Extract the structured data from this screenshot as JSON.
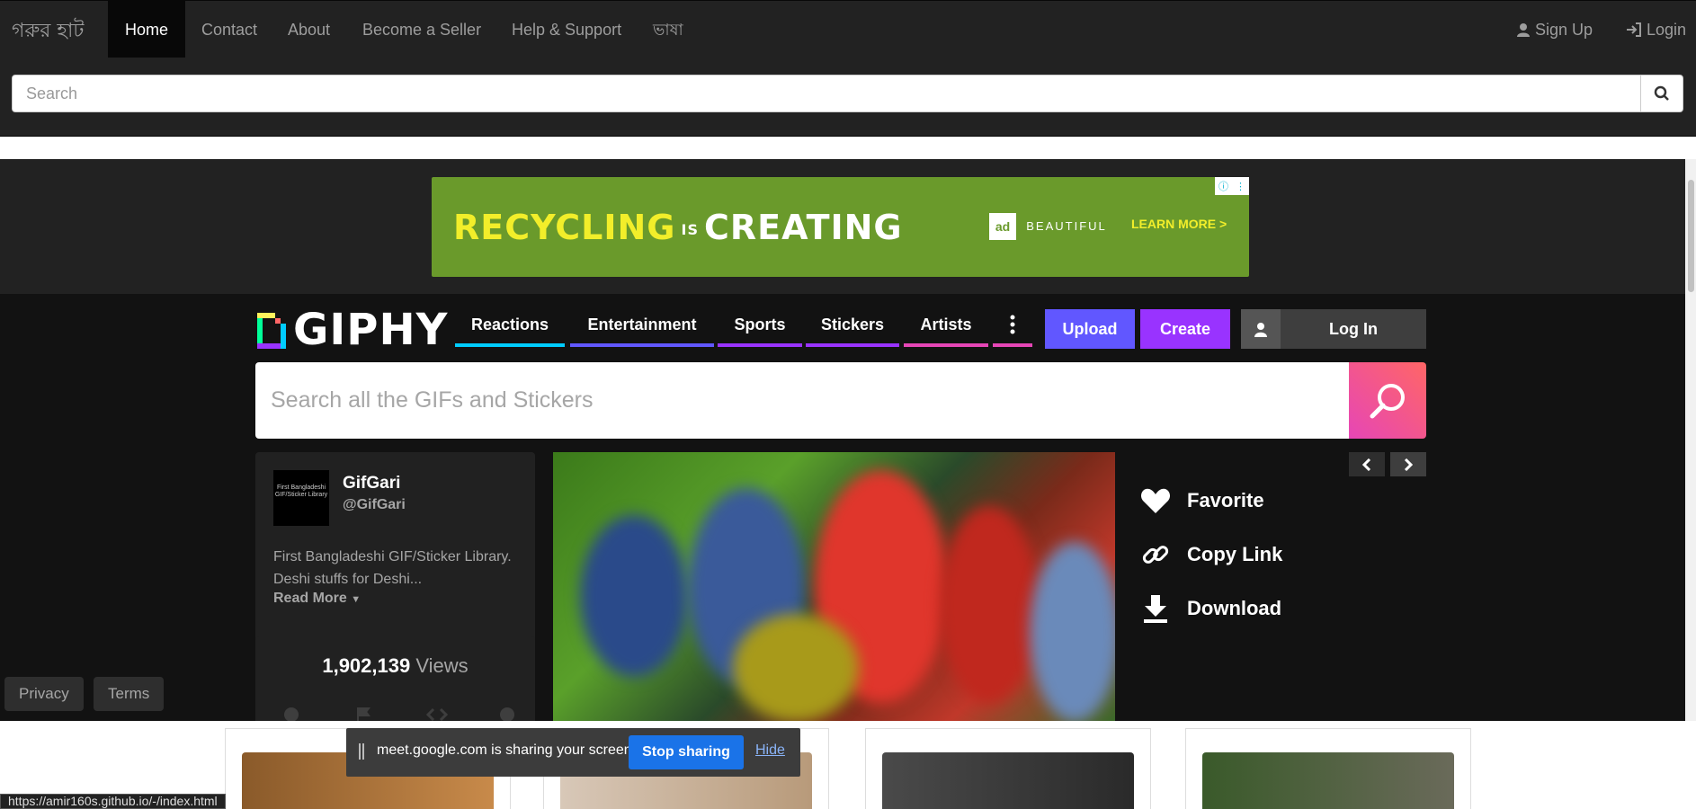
{
  "site": {
    "brand": "গরুর হাট",
    "nav": [
      "Home",
      "Contact",
      "About",
      "Become a Seller",
      "Help & Support",
      "ভাষা"
    ],
    "sign_up": "Sign Up",
    "login": "Login",
    "search_placeholder": "Search"
  },
  "ad": {
    "headline_1": "RECYCLING",
    "is": "IS",
    "headline_2": "CREATING",
    "logo": "ad",
    "brand": "BEAUTIFUL",
    "cta": "LEARN MORE >"
  },
  "giphy": {
    "logo": "GIPHY",
    "nav": [
      {
        "label": "Reactions",
        "color": "#00ccff"
      },
      {
        "label": "Entertainment",
        "color": "#6157ff"
      },
      {
        "label": "Sports",
        "color": "#9933ff"
      },
      {
        "label": "Stickers",
        "color": "#9933ff"
      },
      {
        "label": "Artists",
        "color": "#e646b6"
      }
    ],
    "upload": "Upload",
    "create": "Create",
    "login": "Log In",
    "search_placeholder": "Search all the GIFs and Stickers",
    "user": {
      "avatar_text": "First Bangladeshi GIF/Sticker Library",
      "name": "GifGari",
      "handle": "@GifGari",
      "bio": "First Bangladeshi GIF/Sticker Library. Deshi stuffs for Deshi...",
      "read_more": "Read More"
    },
    "views_count": "1,902,139",
    "views_label": "Views",
    "actions": [
      "Favorite",
      "Copy Link",
      "Download"
    ],
    "footer": [
      "Privacy",
      "Terms"
    ]
  },
  "share_bar": {
    "message": "meet.google.com is sharing your screen.",
    "stop": "Stop sharing",
    "hide": "Hide"
  },
  "status_url": "https://amir160s.github.io/-/index.html"
}
